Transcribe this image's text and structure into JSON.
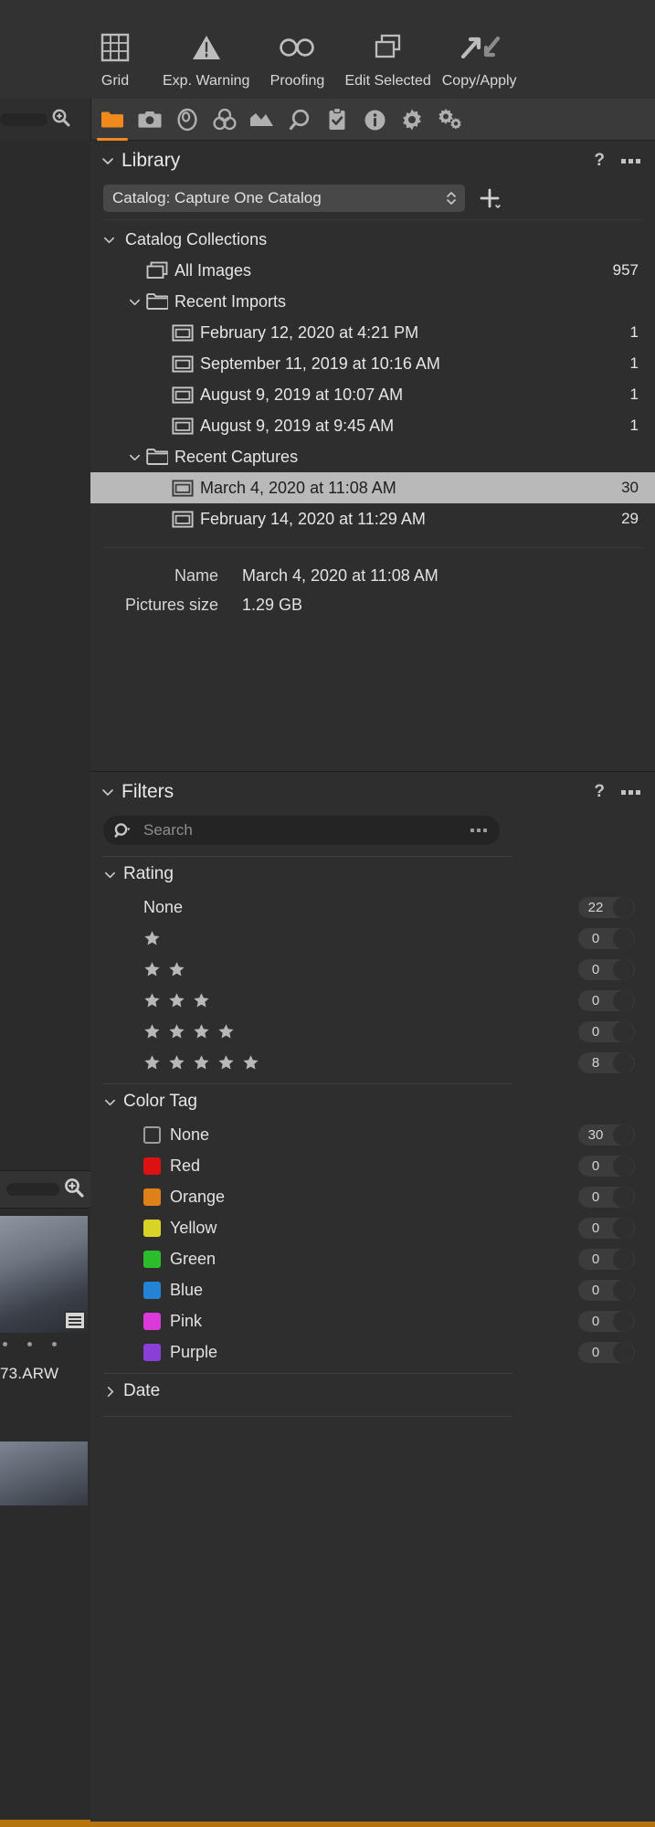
{
  "toolbar": {
    "items": [
      {
        "label": "Grid",
        "icon": "grid-icon"
      },
      {
        "label": "Exp. Warning",
        "icon": "warning-triangle-icon"
      },
      {
        "label": "Proofing",
        "icon": "glasses-icon"
      },
      {
        "label": "Edit Selected",
        "icon": "edit-selected-icon"
      },
      {
        "label": "Copy/Apply",
        "icon": "copy-apply-arrows-icon"
      }
    ]
  },
  "tool_tabs": [
    {
      "name": "library-tab",
      "icon": "folder-icon",
      "active": true
    },
    {
      "name": "capture-tab",
      "icon": "camera-icon",
      "active": false
    },
    {
      "name": "lens-tab",
      "icon": "lens-icon",
      "active": false
    },
    {
      "name": "color-tab",
      "icon": "color-circles-icon",
      "active": false
    },
    {
      "name": "exposure-tab",
      "icon": "histogram-icon",
      "active": false
    },
    {
      "name": "details-tab",
      "icon": "magnifier-icon",
      "active": false
    },
    {
      "name": "adjustments-tab",
      "icon": "clipboard-check-icon",
      "active": false
    },
    {
      "name": "metadata-tab",
      "icon": "info-icon",
      "active": false
    },
    {
      "name": "output-tab",
      "icon": "gear-icon",
      "active": false
    },
    {
      "name": "batch-tab",
      "icon": "multi-gear-icon",
      "active": false
    }
  ],
  "library": {
    "title": "Library",
    "help_label": "?",
    "more_label": "...",
    "catalog": {
      "value": "Catalog: Capture One Catalog",
      "add_label": "+"
    },
    "tree": [
      {
        "label": "Catalog Collections",
        "count": "",
        "indent": 0,
        "chevron": "down",
        "icon": "",
        "selected": false
      },
      {
        "label": "All Images",
        "count": "957",
        "indent": 1,
        "chevron": "",
        "icon": "stack-icon",
        "selected": false
      },
      {
        "label": "Recent Imports",
        "count": "",
        "indent": 1,
        "chevron": "down",
        "icon": "folder-icon",
        "selected": false
      },
      {
        "label": "February 12, 2020 at 4:21 PM",
        "count": "1",
        "indent": 2,
        "chevron": "",
        "icon": "album-icon",
        "selected": false
      },
      {
        "label": "September 11, 2019 at 10:16 AM",
        "count": "1",
        "indent": 2,
        "chevron": "",
        "icon": "album-icon",
        "selected": false
      },
      {
        "label": "August 9, 2019 at 10:07 AM",
        "count": "1",
        "indent": 2,
        "chevron": "",
        "icon": "album-icon",
        "selected": false
      },
      {
        "label": "August 9, 2019 at 9:45 AM",
        "count": "1",
        "indent": 2,
        "chevron": "",
        "icon": "album-icon",
        "selected": false
      },
      {
        "label": "Recent Captures",
        "count": "",
        "indent": 1,
        "chevron": "down",
        "icon": "folder-icon",
        "selected": false
      },
      {
        "label": "March 4, 2020 at 11:08 AM",
        "count": "30",
        "indent": 2,
        "chevron": "",
        "icon": "album-icon",
        "selected": true
      },
      {
        "label": "February 14, 2020 at 11:29 AM",
        "count": "29",
        "indent": 2,
        "chevron": "",
        "icon": "album-icon",
        "selected": false
      }
    ],
    "metadata": [
      {
        "key": "Name",
        "value": "March 4, 2020 at 11:08 AM"
      },
      {
        "key": "Pictures size",
        "value": "1.29 GB"
      }
    ]
  },
  "filters": {
    "title": "Filters",
    "help_label": "?",
    "more_label": "...",
    "search": {
      "placeholder": "Search",
      "value": ""
    },
    "rating": {
      "title": "Rating",
      "rows": [
        {
          "label": "None",
          "stars": 0,
          "count": "22"
        },
        {
          "label": "",
          "stars": 1,
          "count": "0"
        },
        {
          "label": "",
          "stars": 2,
          "count": "0"
        },
        {
          "label": "",
          "stars": 3,
          "count": "0"
        },
        {
          "label": "",
          "stars": 4,
          "count": "0"
        },
        {
          "label": "",
          "stars": 5,
          "count": "8"
        }
      ]
    },
    "color_tag": {
      "title": "Color Tag",
      "rows": [
        {
          "label": "None",
          "color": "none",
          "count": "30"
        },
        {
          "label": "Red",
          "color": "#dd1111",
          "count": "0"
        },
        {
          "label": "Orange",
          "color": "#df8018",
          "count": "0"
        },
        {
          "label": "Yellow",
          "color": "#d9d328",
          "count": "0"
        },
        {
          "label": "Green",
          "color": "#2bbd2b",
          "count": "0"
        },
        {
          "label": "Blue",
          "color": "#2383d4",
          "count": "0"
        },
        {
          "label": "Pink",
          "color": "#d93ad9",
          "count": "0"
        },
        {
          "label": "Purple",
          "color": "#8a3fd6",
          "count": "0"
        }
      ]
    },
    "date": {
      "title": "Date"
    }
  },
  "browser": {
    "filename": "73.ARW",
    "search_placeholder": ""
  },
  "colors": {
    "accent": "#f08a1e",
    "panel_bg": "#2e2e2e",
    "selection": "#b9b9b9"
  }
}
